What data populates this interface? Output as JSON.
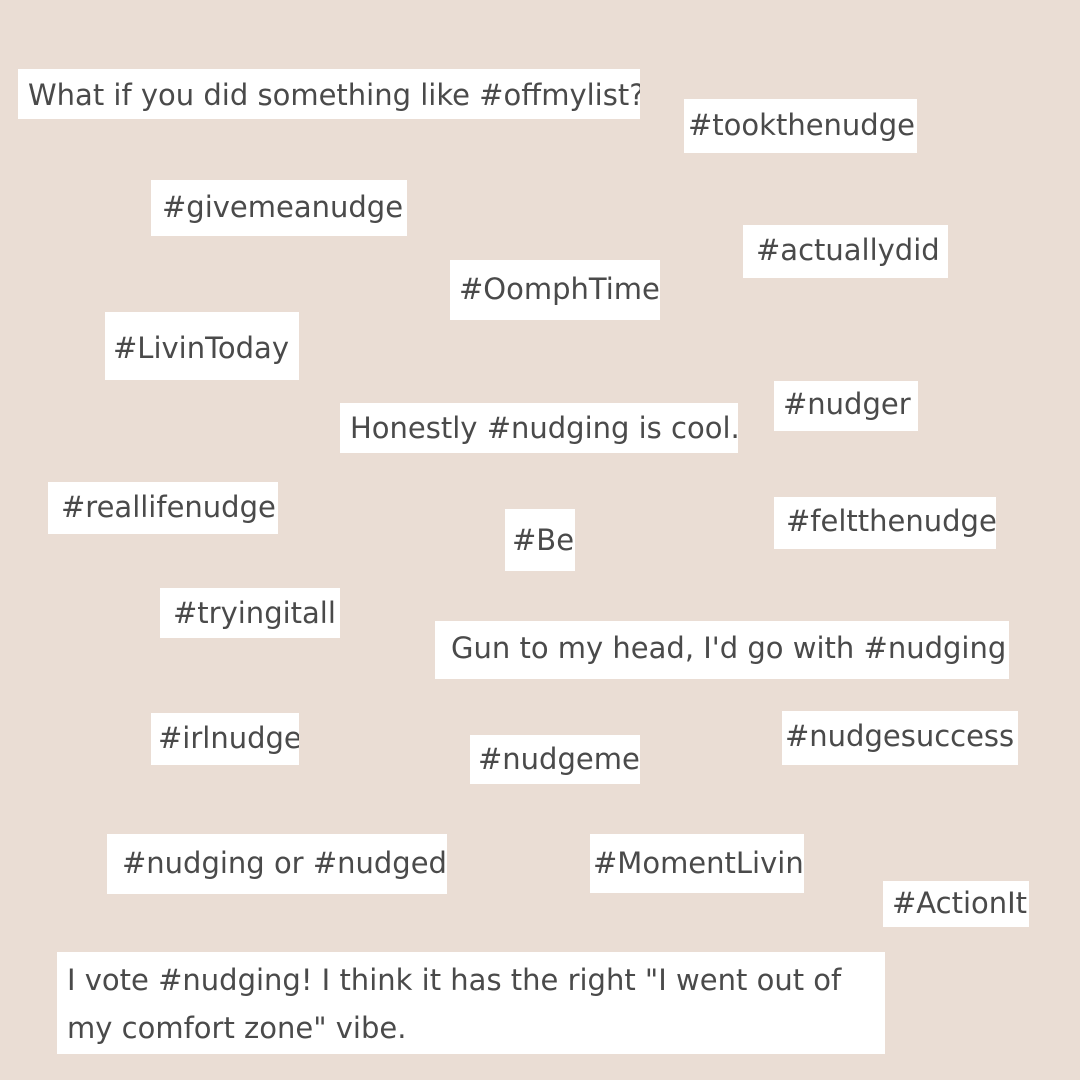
{
  "notes": [
    "What if you did something like #offmylist?",
    "#tookthenudge",
    "#givemeanudge",
    "#actuallydid",
    "#OomphTime",
    "#LivinToday",
    "#nudger",
    "Honestly #nudging is cool.",
    "#reallifenudge",
    "#Be",
    "#feltthenudge",
    "#tryingitall",
    "Gun to my head, I'd go with #nudging!",
    "#irlnudge",
    "#nudgeme",
    "#nudgesuccess",
    "#nudging or #nudged",
    "#MomentLivin",
    "#ActionIt",
    "I vote #nudging! I think it has the right \"I went out of my comfort zone\" vibe."
  ],
  "colors": {
    "background": "#eaddd4",
    "note_background": "#ffffff",
    "text": "#4a4a4a"
  }
}
